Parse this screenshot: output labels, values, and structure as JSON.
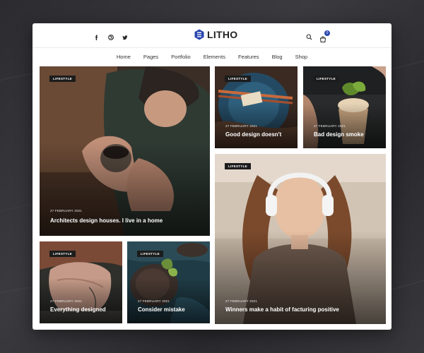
{
  "site": {
    "logo_text": "LITHO"
  },
  "header": {
    "social_icons": [
      "facebook-icon",
      "dribbble-icon",
      "twitter-icon"
    ],
    "search_icon": "search-icon",
    "cart_icon": "cart-icon",
    "cart_count": "0"
  },
  "nav": {
    "items": [
      "Home",
      "Pages",
      "Portfolio",
      "Elements",
      "Features",
      "Blog",
      "Shop"
    ]
  },
  "posts": [
    {
      "tag": "LIFESTYLE",
      "date": "27 FEBRUARY 2021",
      "title": "Architects design houses. I live in a home"
    },
    {
      "tag": "LIFESTYLE",
      "date": "27 FEBRUARY 2021",
      "title": "Good design doesn't"
    },
    {
      "tag": "LIFESTYLE",
      "date": "27 FEBRUARY 2021",
      "title": "Bad design smoke"
    },
    {
      "tag": "LIFESTYLE",
      "date": "27 FEBRUARY 2021",
      "title": "Winners make a habit of facturing positive"
    },
    {
      "tag": "LIFESTYLE",
      "date": "27 FEBRUARY 2021",
      "title": "Everything designed"
    },
    {
      "tag": "LIFESTYLE",
      "date": "27 FEBRUARY 2021",
      "title": "Consider mistake"
    }
  ],
  "colors": {
    "accent": "#2946b0",
    "tag_bg": "#1c1c1c"
  }
}
